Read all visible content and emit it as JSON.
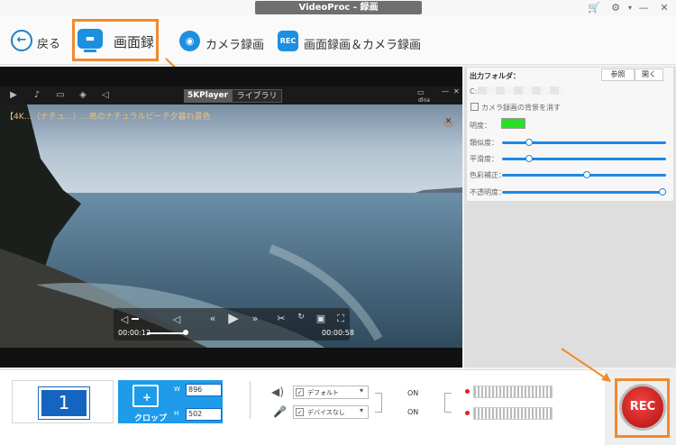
{
  "window": {
    "title": "VideoProc - 録画",
    "cart_icon": "cart-icon",
    "settings_icon": "gear-icon"
  },
  "toolbar": {
    "back_label": "戻る",
    "screen_label": "画面録",
    "camera_label": "カメラ録画",
    "both_label": "画面録画＆カメラ録画",
    "both_icon_text": "REC"
  },
  "player": {
    "tab_5k": "5KPlayer",
    "tab_library": "ライブラリ",
    "dlna": "dlna",
    "video_title": "【4K…（ナチュ…）…島のナチュラルビーチ夕暮れ景色",
    "current_time": "00:00:12",
    "end_time": "00:00:58",
    "progress": 0.21
  },
  "settings": {
    "output_folder_label": "出力フォルダ：",
    "browse_button": "参照",
    "open_button": "開く",
    "path": "C:",
    "erase_bg_label": "カメラ録画の背景を消す",
    "brightness_label": "明度：",
    "sliders": [
      {
        "label": "類似度：",
        "value": 0.15
      },
      {
        "label": "平滑度：",
        "value": 0.15
      },
      {
        "label": "色彩補正：",
        "value": 0.52
      },
      {
        "label": "不透明度：",
        "value": 1.0
      }
    ],
    "colors": {
      "brightness_swatch": "#27e027",
      "accent": "#1e88e5"
    }
  },
  "bottom": {
    "screen_number": "1",
    "crop_label": "クロップ",
    "w_label": "W",
    "h_label": "H",
    "width": "896",
    "height": "502",
    "audio_default": "デフォルト",
    "mic_device": "デバイスなし",
    "on1": "ON",
    "on2": "ON",
    "rec_label": "REC"
  }
}
